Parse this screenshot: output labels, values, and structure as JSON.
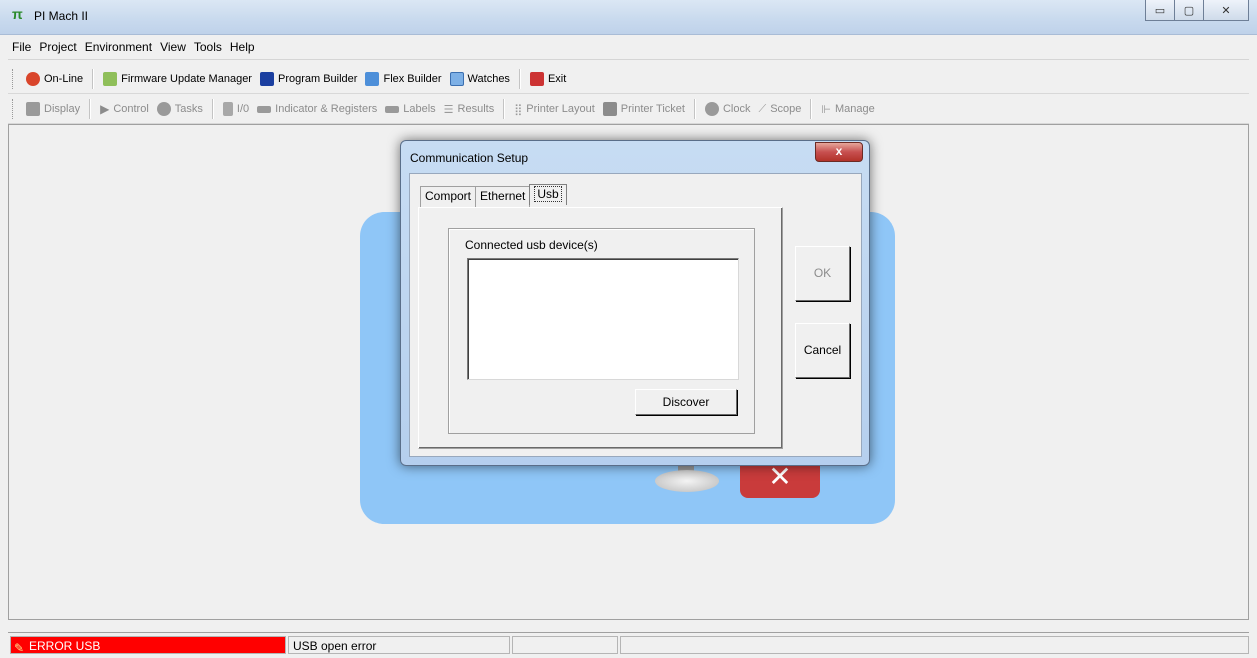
{
  "window": {
    "title": "PI Mach II",
    "app_icon": "pi-mach-icon",
    "controls": [
      "minimize",
      "maximize",
      "close"
    ]
  },
  "menu": [
    "File",
    "Project",
    "Environment",
    "View",
    "Tools",
    "Help"
  ],
  "toolbar1": {
    "online": "On-Line",
    "firmware": "Firmware Update Manager",
    "program_builder": "Program Builder",
    "flex_builder": "Flex Builder",
    "watches": "Watches",
    "exit": "Exit"
  },
  "toolbar2": {
    "display": "Display",
    "control": "Control",
    "tasks": "Tasks",
    "io": "I/0",
    "indicator": "Indicator & Registers",
    "labels": "Labels",
    "results": "Results",
    "printer_layout": "Printer Layout",
    "printer_ticket": "Printer Ticket",
    "clock": "Clock",
    "scope": "Scope",
    "manage": "Manage"
  },
  "dialog": {
    "title": "Communication Setup",
    "close_glyph": "x",
    "tabs": [
      "Comport",
      "Ethernet",
      "Usb"
    ],
    "active_tab": "Usb",
    "group_label": "Connected usb device(s)",
    "discover": "Discover",
    "ok": "OK",
    "cancel": "Cancel"
  },
  "status": {
    "error": "ERROR USB",
    "message": "USB open error"
  },
  "colors": {
    "error_bg": "#ff0000",
    "splash_bg": "#8fc6f7"
  }
}
